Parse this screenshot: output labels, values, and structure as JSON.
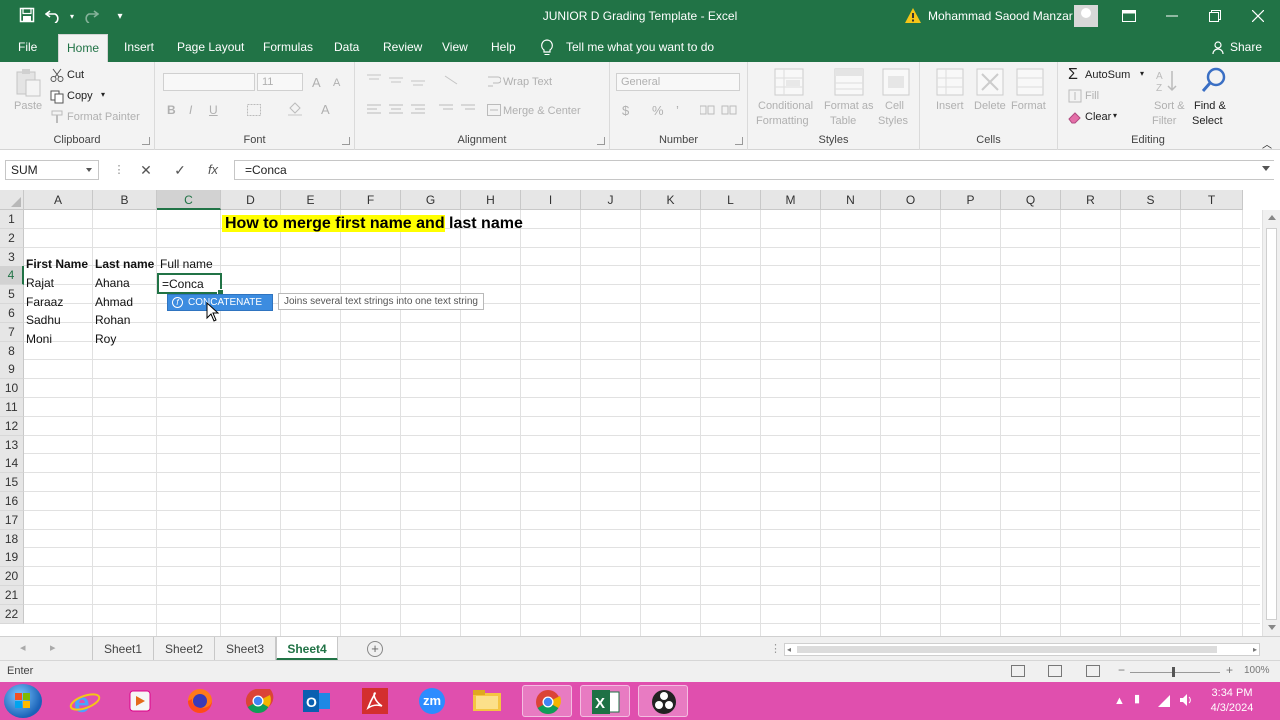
{
  "window": {
    "title": "JUNIOR D Grading Template  -  Excel",
    "user": "Mohammad Saood Manzar"
  },
  "menu": {
    "tabs": [
      "File",
      "Home",
      "Insert",
      "Page Layout",
      "Formulas",
      "Data",
      "Review",
      "View",
      "Help"
    ],
    "active": "Home",
    "tell_me": "Tell me what you want to do",
    "share": "Share"
  },
  "ribbon": {
    "clipboard": {
      "label": "Clipboard",
      "paste": "Paste",
      "cut": "Cut",
      "copy": "Copy",
      "format_painter": "Format Painter"
    },
    "font": {
      "label": "Font",
      "font_name": "",
      "font_size": "11",
      "bold": "B",
      "italic": "I",
      "underline": "U",
      "grow": "A",
      "shrink": "A"
    },
    "alignment": {
      "label": "Alignment",
      "wrap_text": "Wrap Text",
      "merge_center": "Merge & Center"
    },
    "number": {
      "label": "Number",
      "format": "General",
      "currency": "$",
      "percent": "%",
      "comma": "’"
    },
    "styles": {
      "label": "Styles",
      "conditional": "Conditional",
      "conditional2": "Formatting",
      "format_as": "Format as",
      "format_as2": "Table",
      "cell": "Cell",
      "cell2": "Styles"
    },
    "cells": {
      "label": "Cells",
      "insert": "Insert",
      "delete": "Delete",
      "format": "Format"
    },
    "editing": {
      "label": "Editing",
      "autosum": "AutoSum",
      "fill": "Fill",
      "clear": "Clear",
      "sort": "Sort &",
      "sort2": "Filter",
      "find": "Find &",
      "find2": "Select"
    }
  },
  "formula_bar": {
    "name_box": "SUM",
    "cancel": "✕",
    "enter": "✓",
    "fx": "fx",
    "content": "=Conca"
  },
  "grid": {
    "columns": [
      "A",
      "B",
      "C",
      "D",
      "E",
      "F",
      "G",
      "H",
      "I",
      "J",
      "K",
      "L",
      "M",
      "N",
      "O",
      "P",
      "Q",
      "R",
      "S",
      "T"
    ],
    "rows": [
      "1",
      "2",
      "3",
      "4",
      "5",
      "6",
      "7",
      "8",
      "9",
      "10",
      "11",
      "12",
      "13",
      "14",
      "15",
      "16",
      "17",
      "18",
      "19",
      "20",
      "21",
      "22"
    ],
    "title_highlight": "How to merge first name and",
    "title_rest": " last name",
    "header_first": "First Name",
    "header_last": "Last name",
    "header_full": "Full name",
    "first_names": [
      "Rajat",
      "Faraaz",
      "Sadhu",
      "Moni"
    ],
    "last_names": [
      "Ahana",
      "Ahmad",
      "Rohan",
      "Roy"
    ],
    "editing_cell": "=Conca"
  },
  "autocomplete": {
    "item": "CONCATENATE",
    "tooltip": "Joins several text strings into one text string"
  },
  "sheets": {
    "tabs": [
      "Sheet1",
      "Sheet2",
      "Sheet3",
      "Sheet4"
    ],
    "active": "Sheet4",
    "add": "+"
  },
  "status": {
    "mode": "Enter",
    "zoom": "100%"
  },
  "taskbar": {
    "apps": [
      "internet-explorer",
      "media-player",
      "firefox",
      "chrome",
      "outlook",
      "acrobat",
      "zoom",
      "file-explorer",
      "chrome",
      "excel",
      "obs"
    ],
    "zoom_label": "zm",
    "time": "3:34 PM",
    "date": "4/3/2024"
  },
  "colors": {
    "excel_green": "#217346",
    "highlight_yellow": "#ffff00",
    "taskbar_pink": "#e04fae",
    "autocomplete_blue": "#3c8ce0"
  }
}
